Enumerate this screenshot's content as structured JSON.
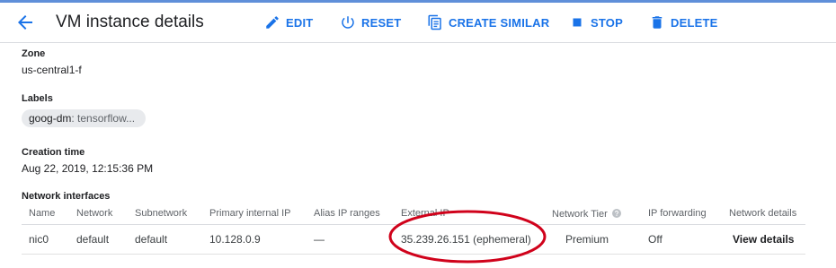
{
  "header": {
    "title": "VM instance details",
    "actions": {
      "edit": "EDIT",
      "reset": "RESET",
      "create_similar": "CREATE SIMILAR",
      "stop": "STOP",
      "delete": "DELETE"
    },
    "accent_color": "#1a73e8"
  },
  "details": {
    "zone": {
      "label": "Zone",
      "value": "us-central1-f"
    },
    "labels": {
      "label": "Labels",
      "chip_key": "goog-dm",
      "chip_value": " : tensorflow..."
    },
    "creation_time": {
      "label": "Creation time",
      "value": "Aug 22, 2019, 12:15:36 PM"
    }
  },
  "network_interfaces": {
    "label": "Network interfaces",
    "columns": {
      "name": "Name",
      "network": "Network",
      "subnetwork": "Subnetwork",
      "primary_ip": "Primary internal IP",
      "alias_ranges": "Alias IP ranges",
      "external_ip": "External IP",
      "network_tier": "Network Tier",
      "ip_forwarding": "IP forwarding",
      "network_details": "Network details"
    },
    "rows": [
      {
        "name": "nic0",
        "network": "default",
        "subnetwork": "default",
        "primary_ip": "10.128.0.9",
        "alias_ranges": "—",
        "external_ip": "35.239.26.151 (ephemeral)",
        "network_tier": "Premium",
        "ip_forwarding": "Off",
        "network_details": "View details"
      }
    ]
  },
  "annotation": {
    "shape": "ellipse",
    "target": "external-ip",
    "color": "#d0021b"
  },
  "icons": [
    "back-arrow-icon",
    "pencil-icon",
    "power-icon",
    "copy-icon",
    "stop-icon",
    "trash-icon",
    "help-icon"
  ]
}
